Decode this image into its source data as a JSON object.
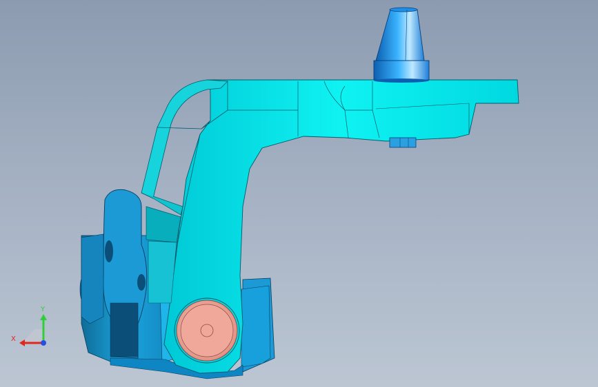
{
  "viewport": {
    "background_top": "#8c9bb0",
    "background_bottom": "#bcc6d3"
  },
  "model": {
    "parts": [
      {
        "name": "bracket-arm",
        "color": "#00e5e5",
        "shade": "#00bcc8"
      },
      {
        "name": "base-block",
        "color": "#1ba6e0",
        "shade": "#0f6c98"
      },
      {
        "name": "mounting-flange",
        "color": "#1b9ad6",
        "shade": "#0b4f78"
      },
      {
        "name": "pivot-pin",
        "color": "#f2a99c",
        "shade": "#c77c70"
      },
      {
        "name": "cone-nozzle",
        "color": "#1f8fe8",
        "shade": "#0c5fb0"
      },
      {
        "name": "stud",
        "color": "#2aa0e0"
      }
    ]
  },
  "triad": {
    "x_label": "X",
    "y_label": "Y",
    "x_color": "#e0261f",
    "y_color": "#2fcf3a",
    "z_color": "#2a4fe0"
  }
}
